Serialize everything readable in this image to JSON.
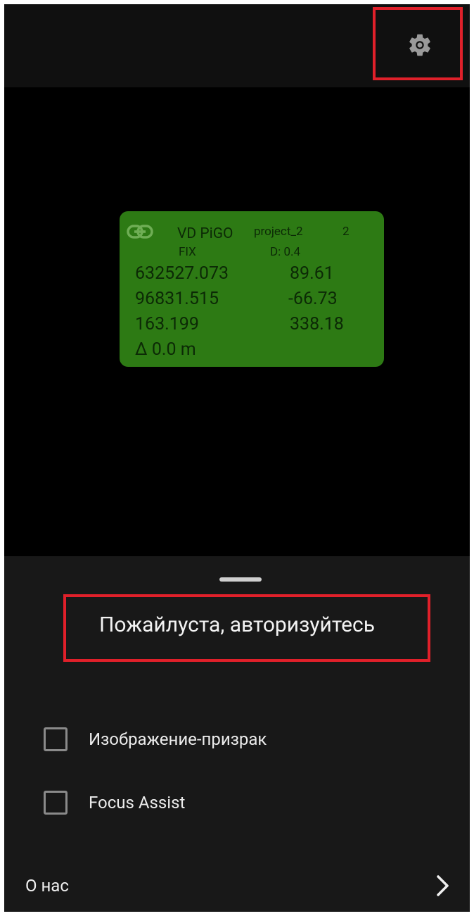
{
  "settings": {
    "icon": "gear-icon"
  },
  "gnss": {
    "link_icon": "link-icon",
    "device": "VD PiGO",
    "project": "project_2",
    "count": "2",
    "status": "FIX",
    "distance": "D: 0.4",
    "easting": "632527.073",
    "northing": "96831.515",
    "height": "163.199",
    "value_1": "89.61",
    "value_2": "-66.73",
    "value_3": "338.18",
    "delta": "Δ 0.0 m"
  },
  "sheet": {
    "auth_message": "Пожайлуста, авторизуйтесь",
    "options": [
      {
        "label": "Изображение-призрак",
        "checked": false
      },
      {
        "label": "Focus Assist",
        "checked": false
      }
    ],
    "about_label": "О нас",
    "chevron_icon": "chevron-right-icon"
  },
  "colors": {
    "card_green": "#2d7a14",
    "highlight_red": "#e0202a",
    "sheet_bg": "#181818"
  }
}
